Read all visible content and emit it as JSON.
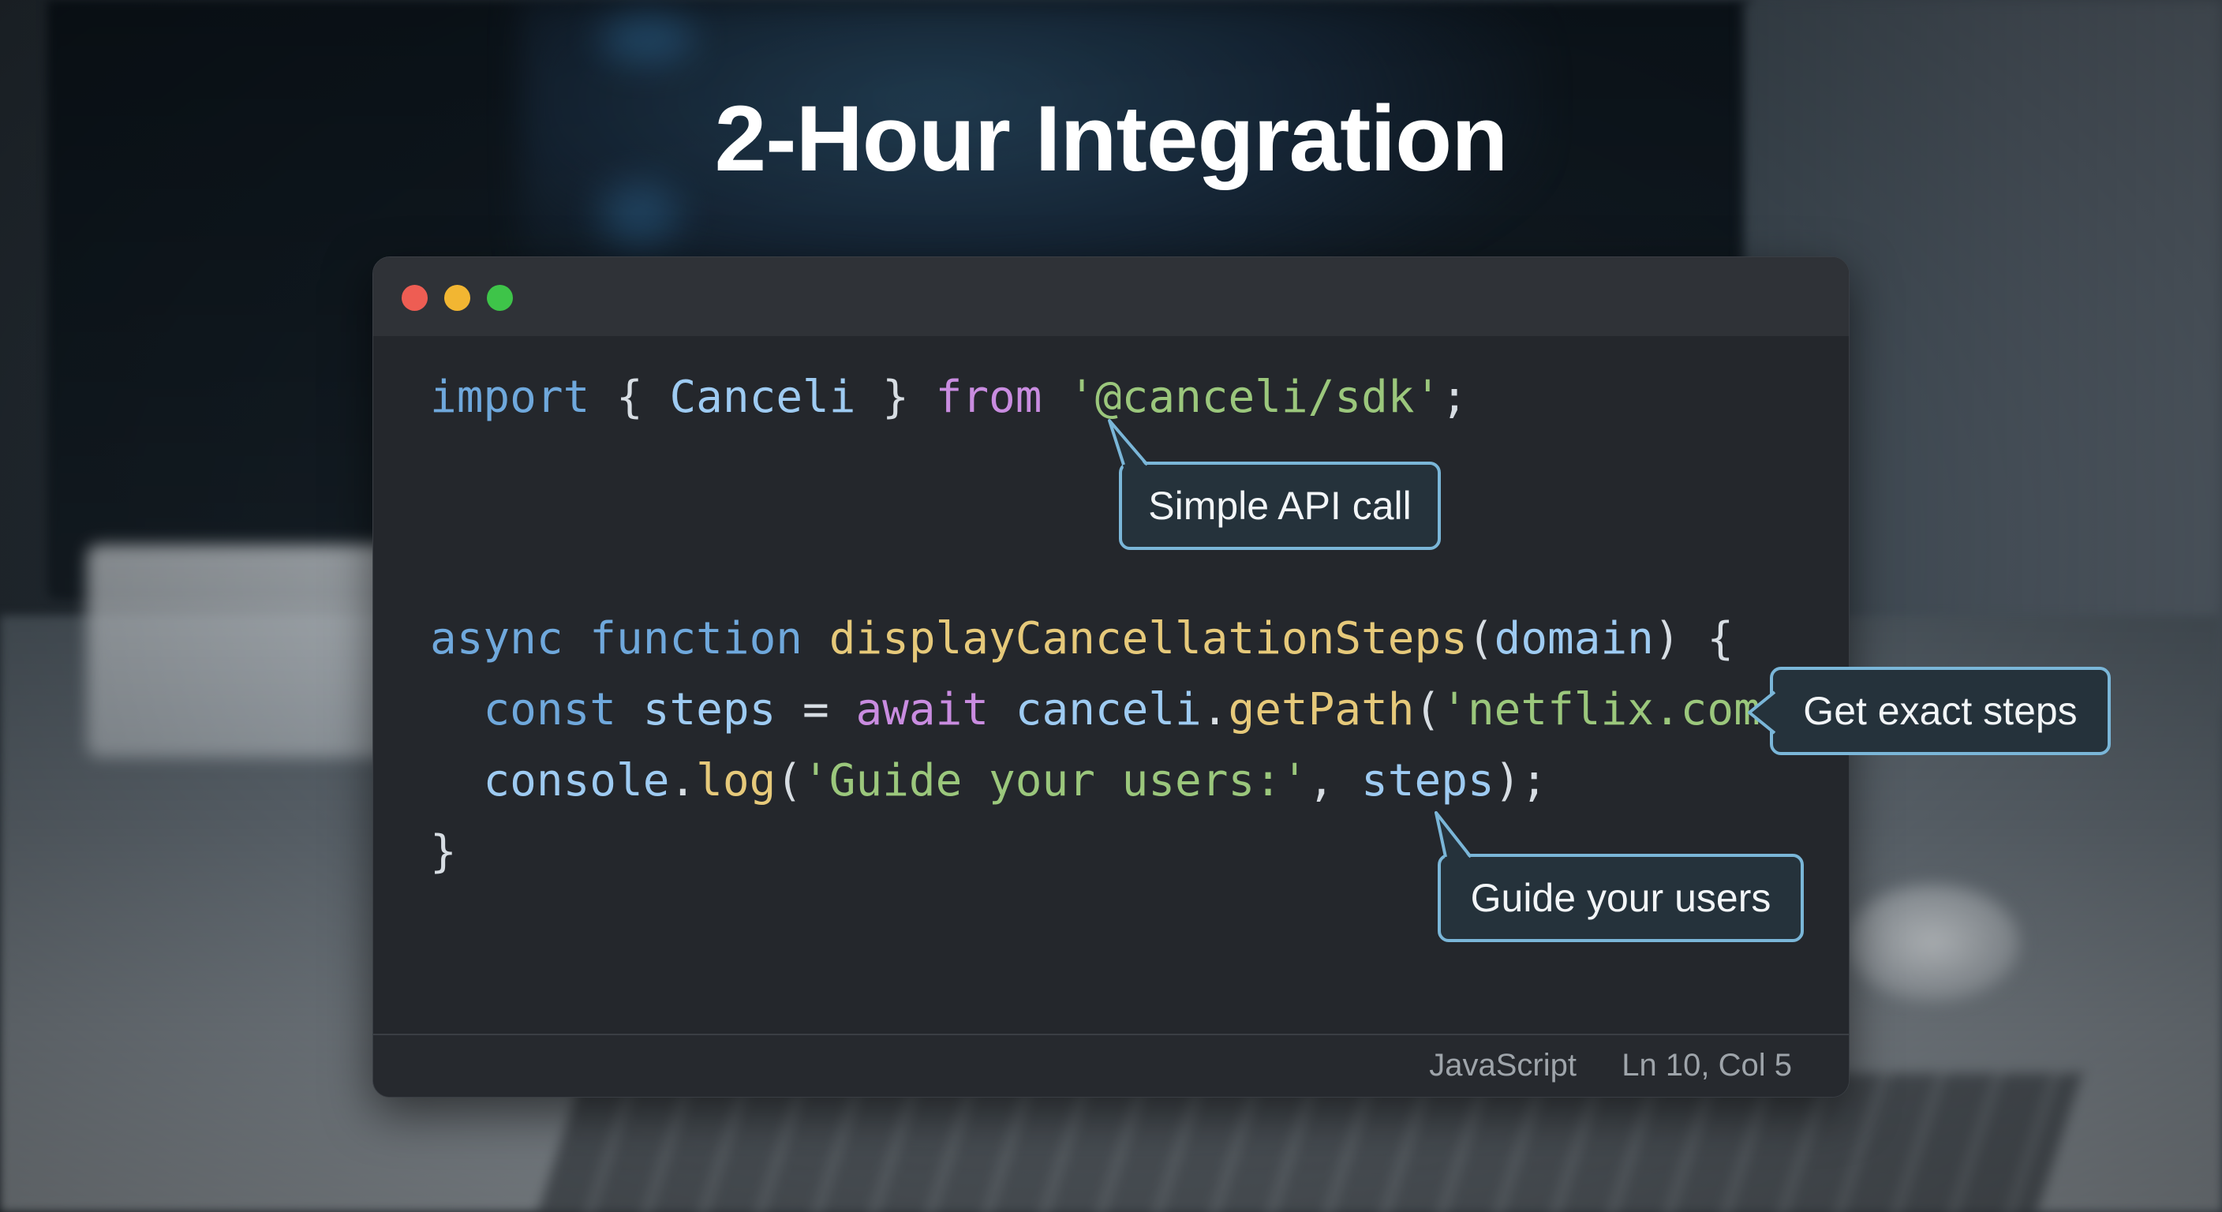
{
  "slide": {
    "title": "2-Hour Integration"
  },
  "window": {
    "controls": [
      "close",
      "minimize",
      "maximize"
    ],
    "colors": {
      "close": "#ee5d53",
      "minimize": "#f2b632",
      "maximize": "#3ec449"
    }
  },
  "code": {
    "language": "JavaScript",
    "lines": [
      [
        [
          "import",
          "blue"
        ],
        [
          " { ",
          "plain"
        ],
        [
          "Canceli",
          "ident"
        ],
        [
          " } ",
          "plain"
        ],
        [
          "from",
          "purple"
        ],
        [
          " ",
          "plain"
        ],
        [
          "'@canceli/sdk'",
          "green"
        ],
        [
          ";",
          "plain"
        ]
      ],
      [],
      [],
      [
        [
          "async",
          "blue"
        ],
        [
          " ",
          "plain"
        ],
        [
          "function",
          "blue"
        ],
        [
          " ",
          "plain"
        ],
        [
          "displayCancellationSteps",
          "yellow"
        ],
        [
          "(",
          "plain"
        ],
        [
          "domain",
          "ident"
        ],
        [
          ") {",
          "plain"
        ]
      ],
      [
        [
          "  ",
          "plain"
        ],
        [
          "const",
          "blue"
        ],
        [
          " ",
          "plain"
        ],
        [
          "steps",
          "ident"
        ],
        [
          " = ",
          "plain"
        ],
        [
          "await",
          "purple"
        ],
        [
          " ",
          "plain"
        ],
        [
          "canceli",
          "ident"
        ],
        [
          ".",
          "plain"
        ],
        [
          "getPath",
          "yellow"
        ],
        [
          "(",
          "plain"
        ],
        [
          "'netflix.com'",
          "green"
        ],
        [
          ");",
          "plain"
        ]
      ],
      [
        [
          "  ",
          "plain"
        ],
        [
          "console",
          "ident"
        ],
        [
          ".",
          "plain"
        ],
        [
          "log",
          "yellow"
        ],
        [
          "(",
          "plain"
        ],
        [
          "'Guide your users:'",
          "green"
        ],
        [
          ", ",
          "plain"
        ],
        [
          "steps",
          "ident"
        ],
        [
          ");",
          "plain"
        ]
      ],
      [
        [
          "}",
          "plain"
        ]
      ]
    ]
  },
  "status_bar": {
    "language": "JavaScript",
    "cursor": "Ln 10, Col 5"
  },
  "callouts": {
    "api": "Simple API call",
    "steps": "Get exact steps",
    "guide": "Guide your users"
  },
  "theme": {
    "accent": "#7ab6d8",
    "keyword": "#6fa8dc",
    "keyword_alt": "#c98ce0",
    "string": "#9bc77c",
    "function": "#e6c97a"
  }
}
